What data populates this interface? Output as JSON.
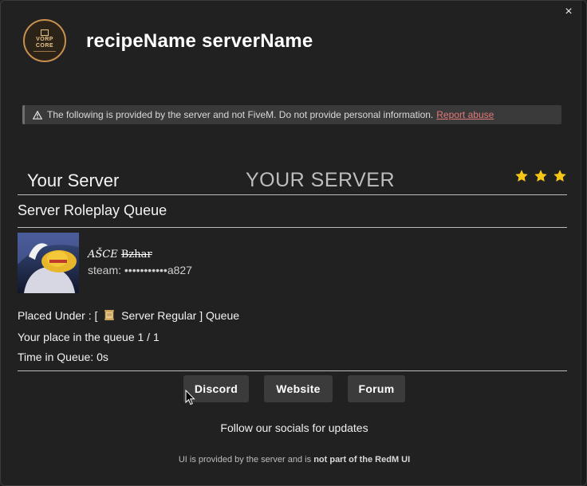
{
  "header": {
    "title": "recipeName serverName",
    "close_glyph": "×",
    "logo": {
      "line1": "VORP",
      "line2": "CORE"
    }
  },
  "notice": {
    "text": "The following is provided by the server and not FiveM. Do not provide personal information.",
    "report_label": "Report abuse",
    "icon": "warning-icon"
  },
  "server": {
    "name": "Your Server",
    "banner": "YOUR SERVER",
    "stars": 3,
    "star_color": "#f5c518"
  },
  "queue": {
    "title": "Server Roleplay Queue",
    "user": {
      "name_prefix": "AŠCE",
      "name_struck": "Bzhar",
      "steam": "steam: •••••••••••a827"
    },
    "placed_prefix": "Placed Under : [",
    "placed_tier": "Server Regular ] Queue",
    "place": "Your place in the queue 1 / 1",
    "time": "Time in Queue: 0s"
  },
  "buttons": {
    "discord": "Discord",
    "website": "Website",
    "forum": "Forum"
  },
  "follow_text": "Follow our socials for updates",
  "footer": {
    "prefix": "UI is provided by the server and is",
    "bold": "not part of the RedM UI"
  },
  "colors": {
    "background": "#212121",
    "notice_bg": "#3a3a3a",
    "button_bg": "#3b3b3b",
    "link": "#e07a7a",
    "logo_ring": "#c8904e"
  }
}
